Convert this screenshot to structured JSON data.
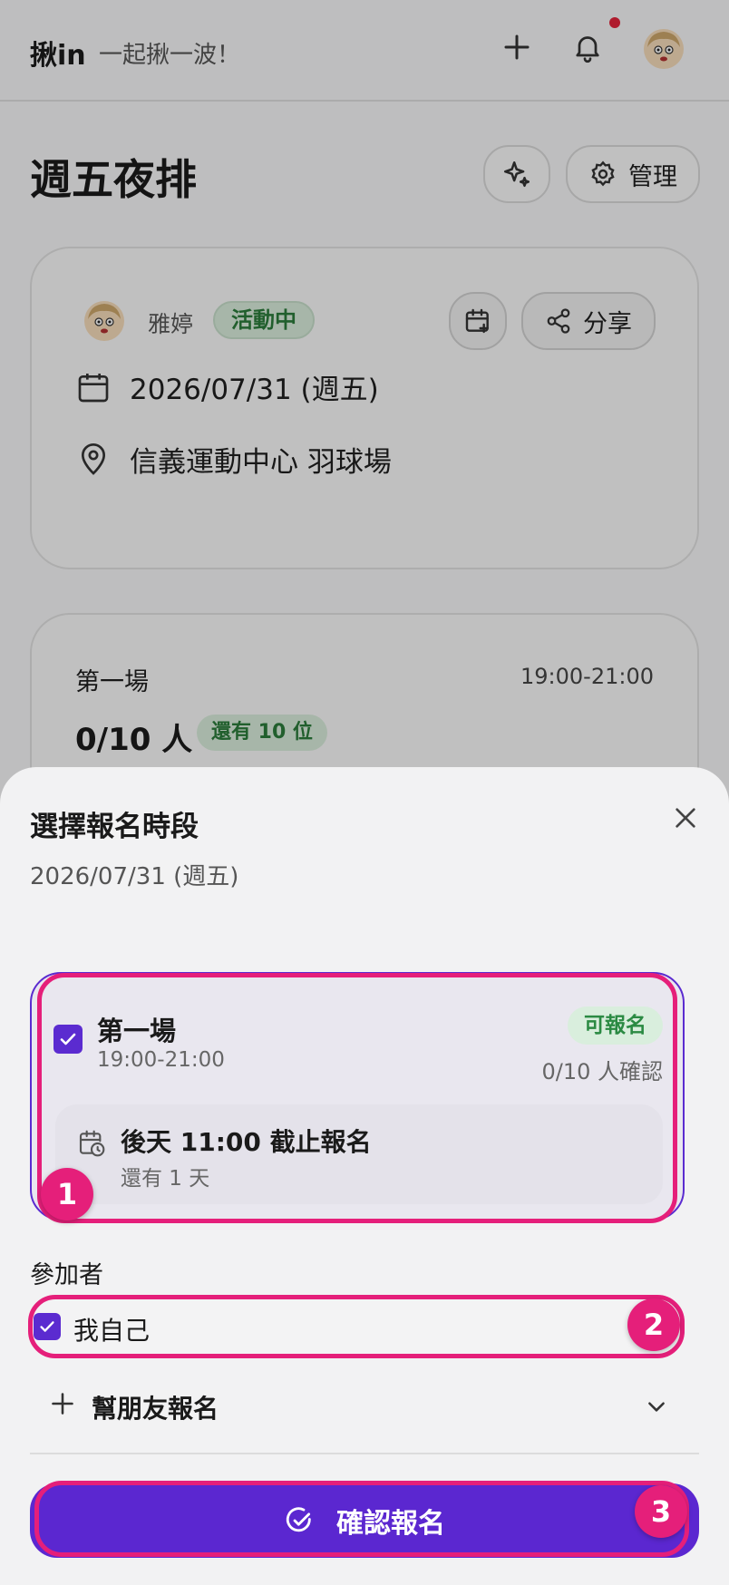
{
  "header": {
    "logo": "揪in",
    "tagline": "一起揪一波！",
    "icons": [
      "plus-icon",
      "bell-icon",
      "avatar"
    ],
    "notification_dot_color": "#e0233a"
  },
  "page": {
    "title": "週五夜排",
    "manage_label": "管理"
  },
  "event_card": {
    "host_name": "雅婷",
    "status_badge": "活動中",
    "share_label": "分享",
    "date": "2026/07/31 (週五)",
    "location": "信義運動中心 羽球場"
  },
  "session_card": {
    "name": "第一場",
    "time": "19:00-21:00",
    "count": "0/10 人",
    "remaining": "還有 10 位"
  },
  "sheet": {
    "title": "選擇報名時段",
    "date": "2026/07/31 (週五)",
    "slot": {
      "name": "第一場",
      "time": "19:00-21:00",
      "status": "可報名",
      "confirmed": "0/10 人確認",
      "checked": true,
      "deadline": "後天 11:00 截止報名",
      "deadline_sub": "還有 1 天"
    },
    "participants_label": "參加者",
    "self_label": "我自己",
    "self_checked": true,
    "help_friend_label": "幫朋友報名",
    "confirm_label": "確認報名"
  },
  "highlights": [
    {
      "number": "1"
    },
    {
      "number": "2"
    },
    {
      "number": "3"
    }
  ],
  "colors": {
    "accent": "#5b27d0",
    "highlight": "#e51f7a",
    "status_green": "#2b8a43"
  }
}
